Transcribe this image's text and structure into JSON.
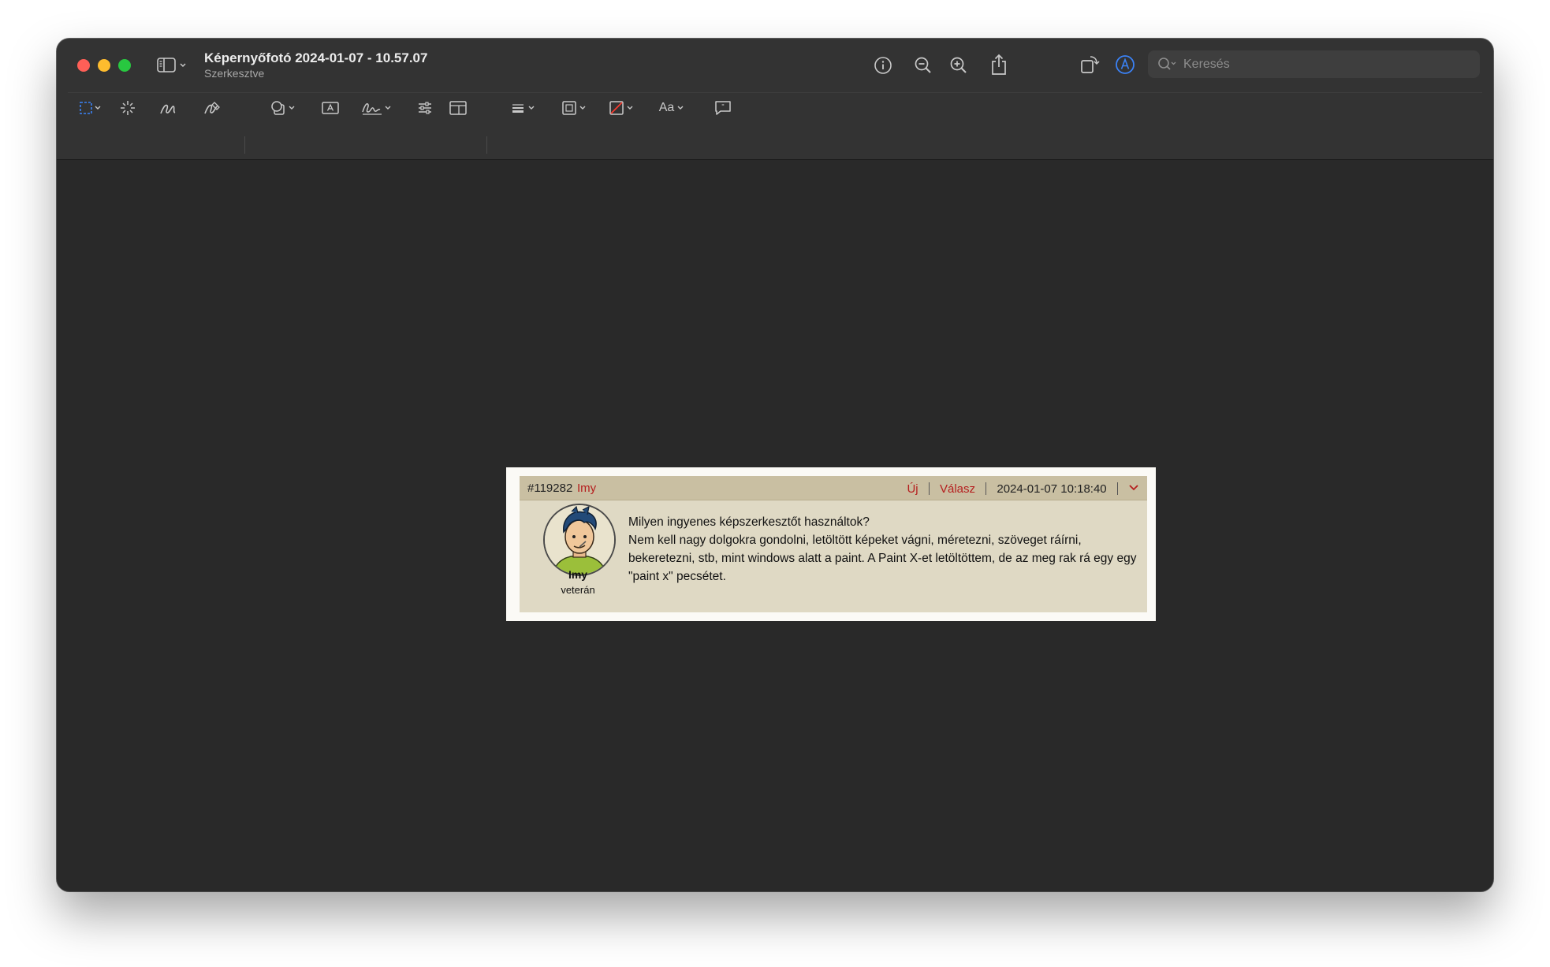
{
  "window": {
    "title": "Képernyőfotó 2024-01-07 - 10.57.07",
    "subtitle": "Szerkesztve"
  },
  "search": {
    "placeholder": "Keresés"
  },
  "toolbar": {
    "font_label": "Aa"
  },
  "post": {
    "id": "#119282",
    "username": "Imy",
    "new_link": "Új",
    "reply_link": "Válasz",
    "datetime": "2024-01-07 10:18:40",
    "avatar_name": "Imy",
    "avatar_rank": "veterán",
    "body_line1": "Milyen ingyenes képszerkesztőt használtok?",
    "body_line2": "Nem kell nagy dolgokra gondolni, letöltött képeket vágni, méretezni, szöveget ráírni, bekeretezni, stb, mint windows alatt a paint. A Paint X-et letöltöttem, de az meg rak rá egy egy \"paint x\" pecsétet."
  },
  "colors": {
    "window_bg": "#2a2a2a",
    "accent_blue": "#3b82f6",
    "post_bg": "#dfd9c4",
    "post_header_bg": "#c9bfa2",
    "link_red": "#b51e1e"
  }
}
